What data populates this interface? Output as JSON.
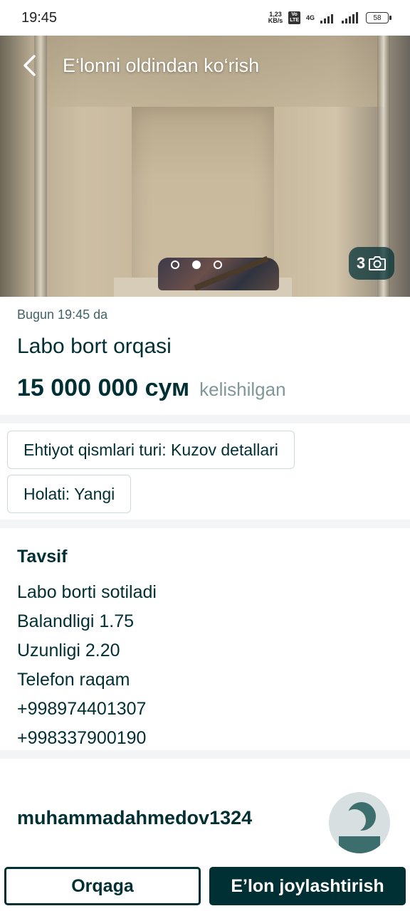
{
  "status_bar": {
    "time": "19:45",
    "net_speed_value": "1,23",
    "net_speed_unit": "KB/s",
    "volte_top": "Vo",
    "volte_bottom": "LTE",
    "network": "4G",
    "battery": "58"
  },
  "header": {
    "title": "E‘lonni oldindan ko‘rish"
  },
  "gallery": {
    "photo_count": "3",
    "dots": 3,
    "active_dot": 2
  },
  "ad": {
    "date": "Bugun 19:45 da",
    "title": "Labo bort orqasi",
    "price": "15 000 000 сум",
    "price_note": "kelishilgan"
  },
  "params": [
    "Ehtiyot qismlari turi: Kuzov detallari",
    "Holati: Yangi"
  ],
  "description": {
    "title": "Tavsif",
    "lines": [
      "Labo borti sotiladi",
      "Balandligi 1.75",
      "Uzunligi 2.20",
      "Telefon raqam",
      "+998974401307",
      "+998337900190"
    ]
  },
  "seller": {
    "name": "muhammadahmedov1324"
  },
  "actions": {
    "back_label": "Orqaga",
    "publish_label": "E’lon joylashtirish"
  },
  "colors": {
    "primary": "#002f34",
    "muted": "#7f9799",
    "divider": "#f2f4f5"
  }
}
